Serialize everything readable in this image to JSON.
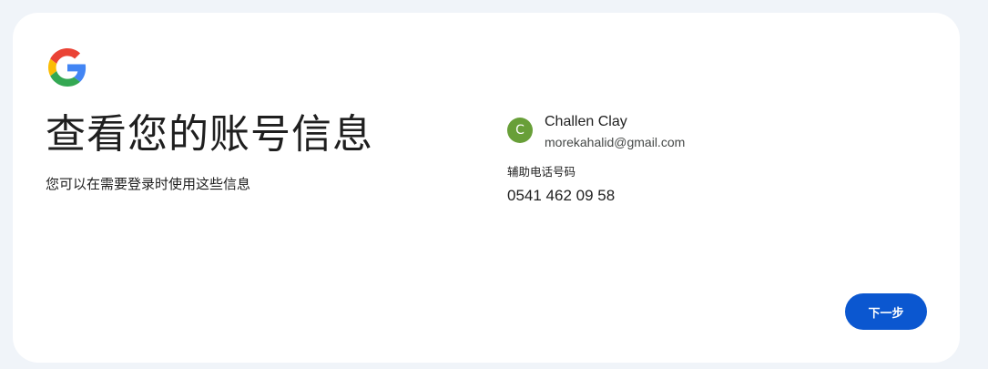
{
  "brand": {
    "logo_icon": "google-g-logo",
    "colors": {
      "blue": "#4285F4",
      "red": "#EA4335",
      "yellow": "#FBBC05",
      "green": "#34A853"
    }
  },
  "heading": {
    "title": "查看您的账号信息",
    "subtitle": "您可以在需要登录时使用这些信息"
  },
  "account": {
    "avatar_letter": "C",
    "avatar_color": "#689f38",
    "name": "Challen Clay",
    "email": "morekahalid@gmail.com"
  },
  "recovery": {
    "label": "辅助电话号码",
    "value": "0541 462 09 58"
  },
  "actions": {
    "next_label": "下一步",
    "next_color": "#0b57d0"
  }
}
